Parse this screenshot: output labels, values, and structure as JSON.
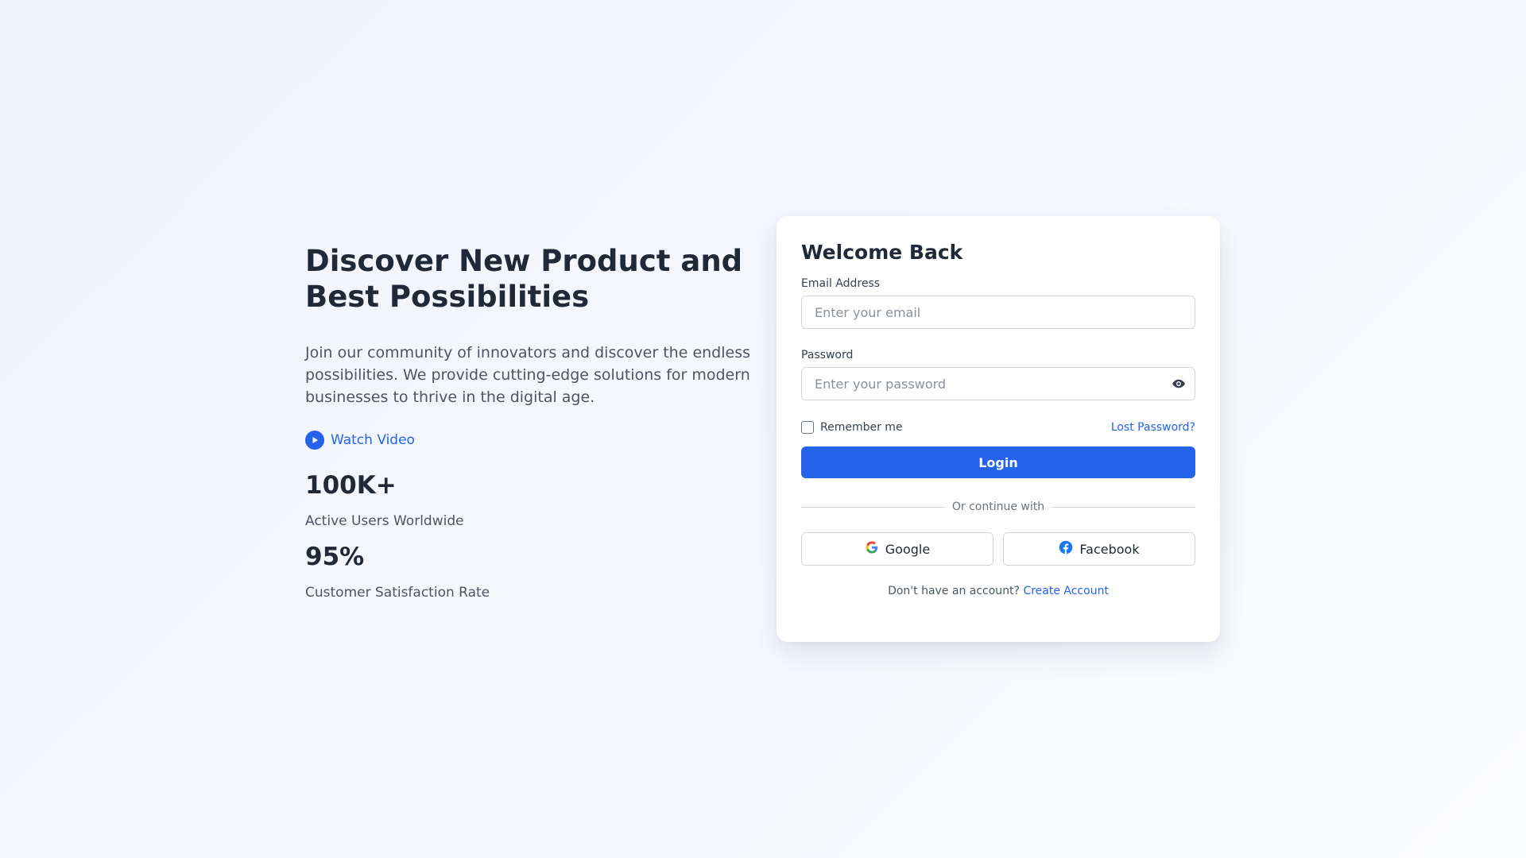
{
  "hero": {
    "title_line1": "Discover New Product and",
    "title_line2": "Best Possibilities",
    "description": "Join our community of innovators and discover the endless possibilities. We provide cutting-edge solutions for modern businesses to thrive in the digital age.",
    "watch_video_label": "Watch Video",
    "stats": [
      {
        "value": "100K+",
        "label": "Active Users Worldwide"
      },
      {
        "value": "95%",
        "label": "Customer Satisfaction Rate"
      }
    ]
  },
  "login": {
    "title": "Welcome Back",
    "email_label": "Email Address",
    "email_placeholder": "Enter your email",
    "password_label": "Password",
    "password_placeholder": "Enter your password",
    "remember_label": "Remember me",
    "remember_checked": false,
    "lost_password_label": "Lost Password?",
    "login_button_label": "Login",
    "divider_text": "Or continue with",
    "google_label": "Google",
    "facebook_label": "Facebook",
    "signup_prompt": "Don't have an account?",
    "signup_link": "Create Account"
  },
  "colors": {
    "accent": "#2563eb",
    "heading": "#1f2937",
    "body_text": "#4b5563"
  },
  "icons": [
    "play-icon",
    "eye-icon",
    "google-icon",
    "facebook-icon"
  ]
}
